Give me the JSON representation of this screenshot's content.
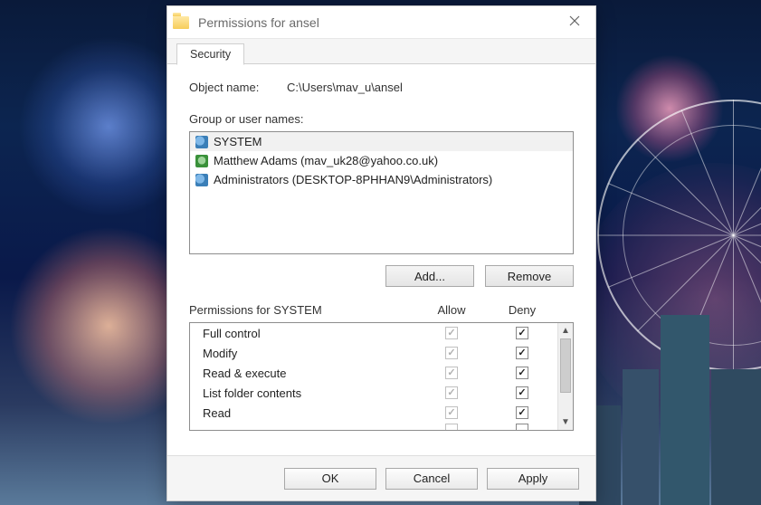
{
  "window": {
    "title": "Permissions for ansel"
  },
  "tabs": {
    "security": "Security"
  },
  "object": {
    "label": "Object name:",
    "path": "C:\\Users\\mav_u\\ansel"
  },
  "principals": {
    "label": "Group or user names:",
    "items": [
      {
        "name": "SYSTEM",
        "iconType": "grp",
        "selected": true
      },
      {
        "name": "Matthew Adams (mav_uk28@yahoo.co.uk)",
        "iconType": "one",
        "selected": false
      },
      {
        "name": "Administrators (DESKTOP-8PHHAN9\\Administrators)",
        "iconType": "grp",
        "selected": false
      }
    ]
  },
  "buttons": {
    "add": "Add...",
    "remove": "Remove",
    "ok": "OK",
    "cancel": "Cancel",
    "apply": "Apply"
  },
  "permissions": {
    "heading": "Permissions for SYSTEM",
    "allow": "Allow",
    "deny": "Deny",
    "rows": [
      {
        "label": "Full control",
        "allowChecked": true,
        "allowDisabled": true,
        "denyChecked": true
      },
      {
        "label": "Modify",
        "allowChecked": true,
        "allowDisabled": true,
        "denyChecked": true
      },
      {
        "label": "Read & execute",
        "allowChecked": true,
        "allowDisabled": true,
        "denyChecked": true
      },
      {
        "label": "List folder contents",
        "allowChecked": true,
        "allowDisabled": true,
        "denyChecked": true
      },
      {
        "label": "Read",
        "allowChecked": true,
        "allowDisabled": true,
        "denyChecked": true
      }
    ]
  }
}
